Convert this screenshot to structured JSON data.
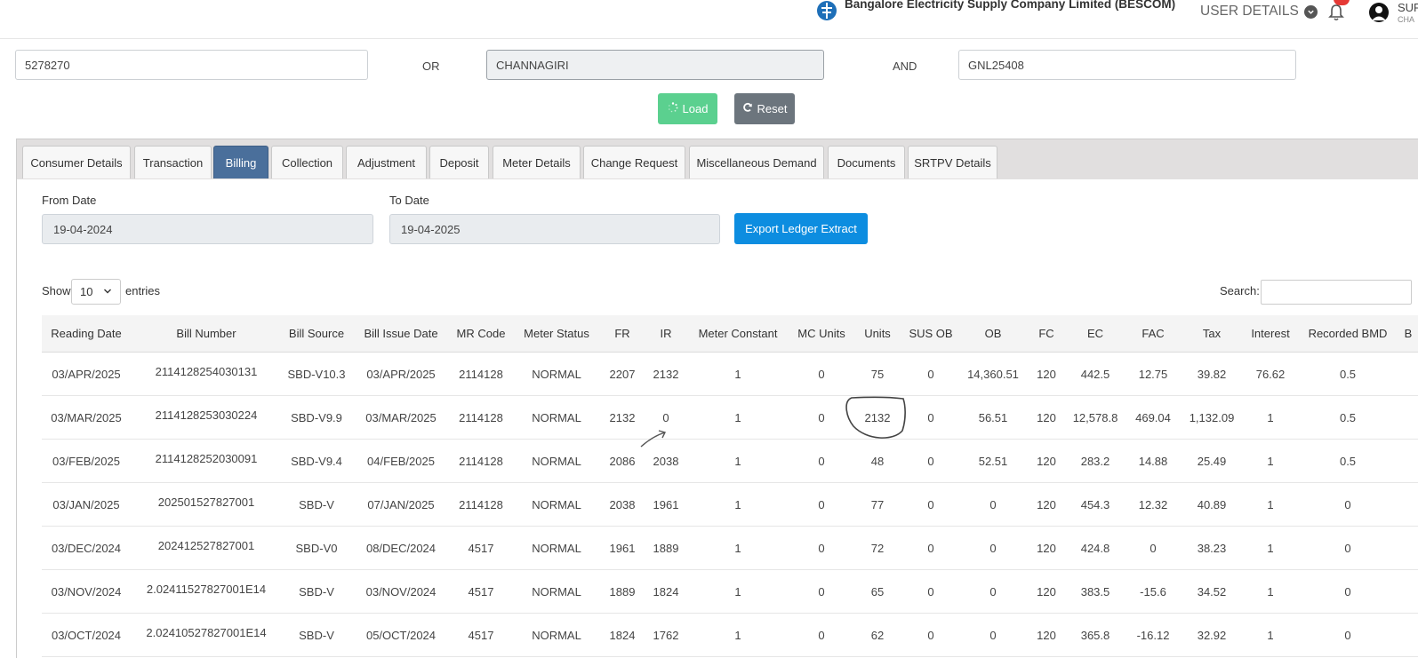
{
  "header": {
    "company_name": "Bangalore Electricity Supply Company Limited (BESCOM)",
    "logo_caption": "BESCOM",
    "user_details_label": "USER DETAILS",
    "user_name_fragment": "SUF",
    "user_sub_fragment": "CHA"
  },
  "search": {
    "account_value": "5278270",
    "or_label": "OR",
    "location_value": "CHANNAGIRI",
    "and_label": "AND",
    "rr_value": "GNL25408",
    "load_label": "Load",
    "reset_label": "Reset"
  },
  "tabs": [
    "Consumer Details",
    "Transaction",
    "Billing",
    "Collection",
    "Adjustment",
    "Deposit",
    "Meter Details",
    "Change Request",
    "Miscellaneous Demand",
    "Documents",
    "SRTPV Details"
  ],
  "active_tab": "Billing",
  "billing": {
    "from_label": "From Date",
    "from_value": "19-04-2024",
    "to_label": "To Date",
    "to_value": "19-04-2025",
    "export_label": "Export Ledger Extract",
    "show_label": "Show",
    "entries_value": "10",
    "entries_label": "entries",
    "search_label": "Search:"
  },
  "table": {
    "headers": [
      "Reading Date",
      "Bill Number",
      "Bill Source",
      "Bill Issue Date",
      "MR Code",
      "Meter Status",
      "FR",
      "IR",
      "Meter Constant",
      "MC Units",
      "Units",
      "SUS OB",
      "OB",
      "FC",
      "EC",
      "FAC",
      "Tax",
      "Interest",
      "Recorded BMD",
      "B"
    ],
    "rows": [
      [
        "03/APR/2025",
        "2114128254030131",
        "SBD-V10.3",
        "03/APR/2025",
        "2114128",
        "NORMAL",
        "2207",
        "2132",
        "1",
        "0",
        "75",
        "0",
        "14,360.51",
        "120",
        "442.5",
        "12.75",
        "39.82",
        "76.62",
        "0.5",
        ""
      ],
      [
        "03/MAR/2025",
        "2114128253030224",
        "SBD-V9.9",
        "03/MAR/2025",
        "2114128",
        "NORMAL",
        "2132",
        "0",
        "1",
        "0",
        "2132",
        "0",
        "56.51",
        "120",
        "12,578.8",
        "469.04",
        "1,132.09",
        "1",
        "0.5",
        ""
      ],
      [
        "03/FEB/2025",
        "2114128252030091",
        "SBD-V9.4",
        "04/FEB/2025",
        "2114128",
        "NORMAL",
        "2086",
        "2038",
        "1",
        "0",
        "48",
        "0",
        "52.51",
        "120",
        "283.2",
        "14.88",
        "25.49",
        "1",
        "0.5",
        ""
      ],
      [
        "03/JAN/2025",
        "202501527827001",
        "SBD-V",
        "07/JAN/2025",
        "2114128",
        "NORMAL",
        "2038",
        "1961",
        "1",
        "0",
        "77",
        "0",
        "0",
        "120",
        "454.3",
        "12.32",
        "40.89",
        "1",
        "0",
        ""
      ],
      [
        "03/DEC/2024",
        "202412527827001",
        "SBD-V0",
        "08/DEC/2024",
        "4517",
        "NORMAL",
        "1961",
        "1889",
        "1",
        "0",
        "72",
        "0",
        "0",
        "120",
        "424.8",
        "0",
        "38.23",
        "1",
        "0",
        ""
      ],
      [
        "03/NOV/2024",
        "2.02411527827001E14",
        "SBD-V",
        "03/NOV/2024",
        "4517",
        "NORMAL",
        "1889",
        "1824",
        "1",
        "0",
        "65",
        "0",
        "0",
        "120",
        "383.5",
        "-15.6",
        "34.52",
        "1",
        "0",
        ""
      ],
      [
        "03/OCT/2024",
        "2.02410527827001E14",
        "SBD-V",
        "05/OCT/2024",
        "4517",
        "NORMAL",
        "1824",
        "1762",
        "1",
        "0",
        "62",
        "0",
        "0",
        "120",
        "365.8",
        "-16.12",
        "32.92",
        "1",
        "0",
        ""
      ]
    ]
  },
  "icons": {
    "logo": "bescom-logo-icon",
    "user_chevron": "chevron-down-icon",
    "notification": "bell-icon",
    "avatar": "user-avatar-icon",
    "load": "spinner-icon",
    "reset": "refresh-icon",
    "select": "chevron-down-icon"
  },
  "colors": {
    "active_tab": "#4a6f9b",
    "load_button": "#5bd08f",
    "reset_button": "#6c757d",
    "export_button": "#0d8de0",
    "notification_badge": "#e53935"
  }
}
